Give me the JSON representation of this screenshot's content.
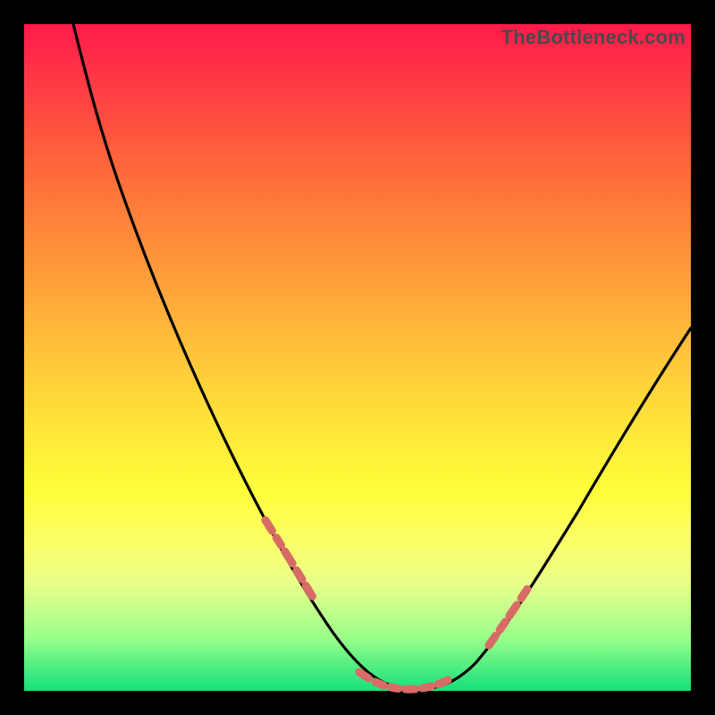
{
  "watermark": "TheBottleneck.com",
  "colors": {
    "frame": "#000000",
    "gradient_top": "#ff1a4b",
    "gradient_bottom": "#14e07a",
    "curve": "#000000",
    "dash": "#d96b66"
  },
  "chart_data": {
    "type": "line",
    "title": "",
    "xlabel": "",
    "ylabel": "",
    "xlim": [
      0,
      100
    ],
    "ylim": [
      0,
      100
    ],
    "grid": false,
    "legend": false,
    "series": [
      {
        "name": "bottleneck-curve",
        "x": [
          0,
          5,
          10,
          15,
          20,
          25,
          30,
          35,
          40,
          45,
          47,
          50,
          53,
          55,
          58,
          60,
          63,
          65,
          70,
          75,
          80,
          85,
          90,
          95,
          100
        ],
        "y": [
          100,
          90,
          80,
          70,
          60,
          50,
          40,
          30,
          21,
          12,
          9,
          5,
          2,
          1,
          0,
          0,
          1,
          3,
          8,
          15,
          23,
          32,
          41,
          50,
          58
        ]
      }
    ],
    "highlight_segments": [
      {
        "x": [
          27,
          46
        ],
        "note": "left descent highlighted band"
      },
      {
        "x": [
          50,
          65
        ],
        "note": "valley floor highlighted band"
      },
      {
        "x": [
          68,
          78
        ],
        "note": "right ascent highlighted band"
      }
    ]
  }
}
